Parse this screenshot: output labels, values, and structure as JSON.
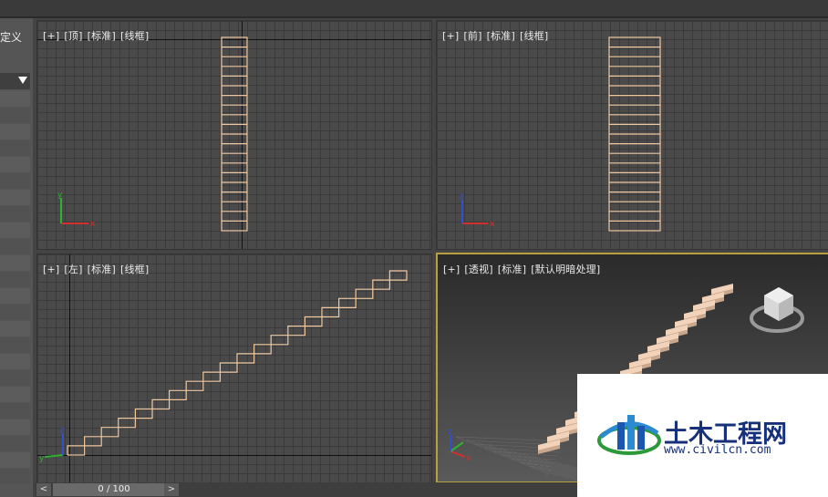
{
  "left_panel": {
    "title": "定义"
  },
  "viewports": {
    "top": {
      "tags": [
        "[+]",
        "[顶]",
        "[标准]",
        "[线框]"
      ]
    },
    "front": {
      "tags": [
        "[+]",
        "[前]",
        "[标准]",
        "[线框]"
      ]
    },
    "left": {
      "tags": [
        "[+]",
        "[左]",
        "[标准]",
        "[线框]"
      ]
    },
    "perspective": {
      "tags": [
        "[+]",
        "[透视]",
        "[标准]",
        "[默认明暗处理]"
      ]
    }
  },
  "axis_labels": {
    "x": "x",
    "y": "y",
    "z": "z"
  },
  "timeline": {
    "prev": "<",
    "next": ">",
    "position": "0 / 100"
  },
  "watermark": {
    "title": "土木工程网",
    "url": "www.civilcn.com"
  },
  "colors": {
    "wire": "#f0c8a0",
    "stair_solid": "#f2d2b8",
    "active_border": "#b8a040",
    "brand": "#16307a"
  }
}
